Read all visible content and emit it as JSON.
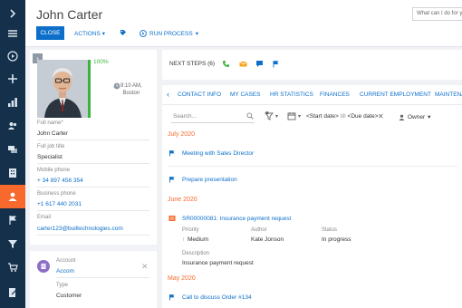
{
  "page": {
    "title": "John Carter",
    "search_placeholder": "What can I do for you?"
  },
  "toolbar": {
    "close_label": "CLOSE",
    "actions_label": "ACTIONS",
    "run_process_label": "RUN PROCESS"
  },
  "profile": {
    "progress_label": "100%",
    "progress_value": 1.0,
    "local_time": "9:10 AM,",
    "location": "Boston",
    "fields": [
      {
        "label": "Full name*",
        "value": "John Carter",
        "link": false
      },
      {
        "label": "Full job title",
        "value": "Specialist",
        "link": false
      },
      {
        "label": "Mobile phone",
        "value": "+ 34 897 456 354",
        "link": true
      },
      {
        "label": "Business phone",
        "value": "+1 617 440 2031",
        "link": true
      },
      {
        "label": "Email",
        "value": "carter123@builtechnologies.com",
        "link": true
      }
    ]
  },
  "account_card": {
    "account_label": "Account",
    "account_value": "Accom",
    "type_label": "Type",
    "type_value": "Customer"
  },
  "next_steps": {
    "label": "NEXT STEPS (6)"
  },
  "tabs": [
    "CONTACT INFO",
    "MY CASES",
    "HR STATISTICS",
    "FINANCES",
    "CURRENT EMPLOYMENT",
    "MAINTENANCE"
  ],
  "filters": {
    "search_placeholder": "Search...",
    "start_date": "<Start date>",
    "till": "till",
    "due_date": "<Due date>",
    "owner_label": "Owner"
  },
  "timeline": {
    "month_july": "July 2020",
    "item_meeting": "Meeting with Sales Director",
    "item_presentation": "Prepare presentation",
    "month_june": "June 2020",
    "case_title": "SR00000081: Insurance payment request",
    "case_priority_label": "Priority",
    "case_priority_value": "Medium",
    "case_author_label": "Author",
    "case_author_value": "Kate Jonson",
    "case_status_label": "Status",
    "case_status_value": "In progress",
    "case_description_label": "Description",
    "case_description_value": "Insurance payment request",
    "month_may": "May 2020",
    "item_call": "Call to discuss Order #134"
  },
  "colors": {
    "accent": "#0d6fca",
    "nav_bg": "#14304a",
    "active_orange": "#f7692d",
    "progress_green": "#3ab43a"
  }
}
